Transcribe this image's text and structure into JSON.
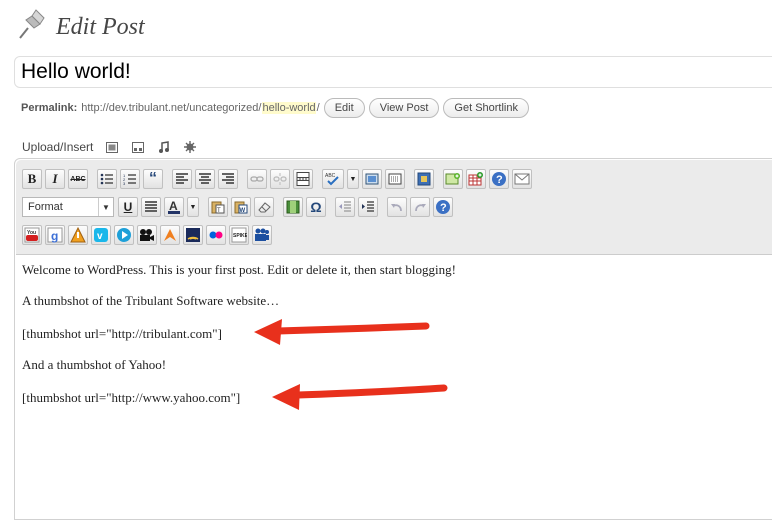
{
  "header": {
    "title": "Edit Post"
  },
  "post": {
    "title_value": "Hello world!"
  },
  "permalink": {
    "label": "Permalink:",
    "base": "http://dev.tribulant.net/uncategorized/",
    "slug": "hello-world",
    "trail": "/",
    "edit_button": "Edit",
    "view_button": "View Post",
    "shortlink_button": "Get Shortlink"
  },
  "upload": {
    "label": "Upload/Insert"
  },
  "toolbar": {
    "format_select": "Format"
  },
  "content": {
    "line1": "Welcome to WordPress. This is your first post. Edit or delete it, then start blogging!",
    "line2": "A thumbshot of the Tribulant Software website…",
    "line3": "[thumbshot url=\"http://tribulant.com\"]",
    "line4": "And a thumbshot of Yahoo!",
    "line5": "[thumbshot url=\"http://www.yahoo.com\"]"
  },
  "colors": {
    "arrow": "#e8301c",
    "slug_highlight": "#fffbcc"
  }
}
